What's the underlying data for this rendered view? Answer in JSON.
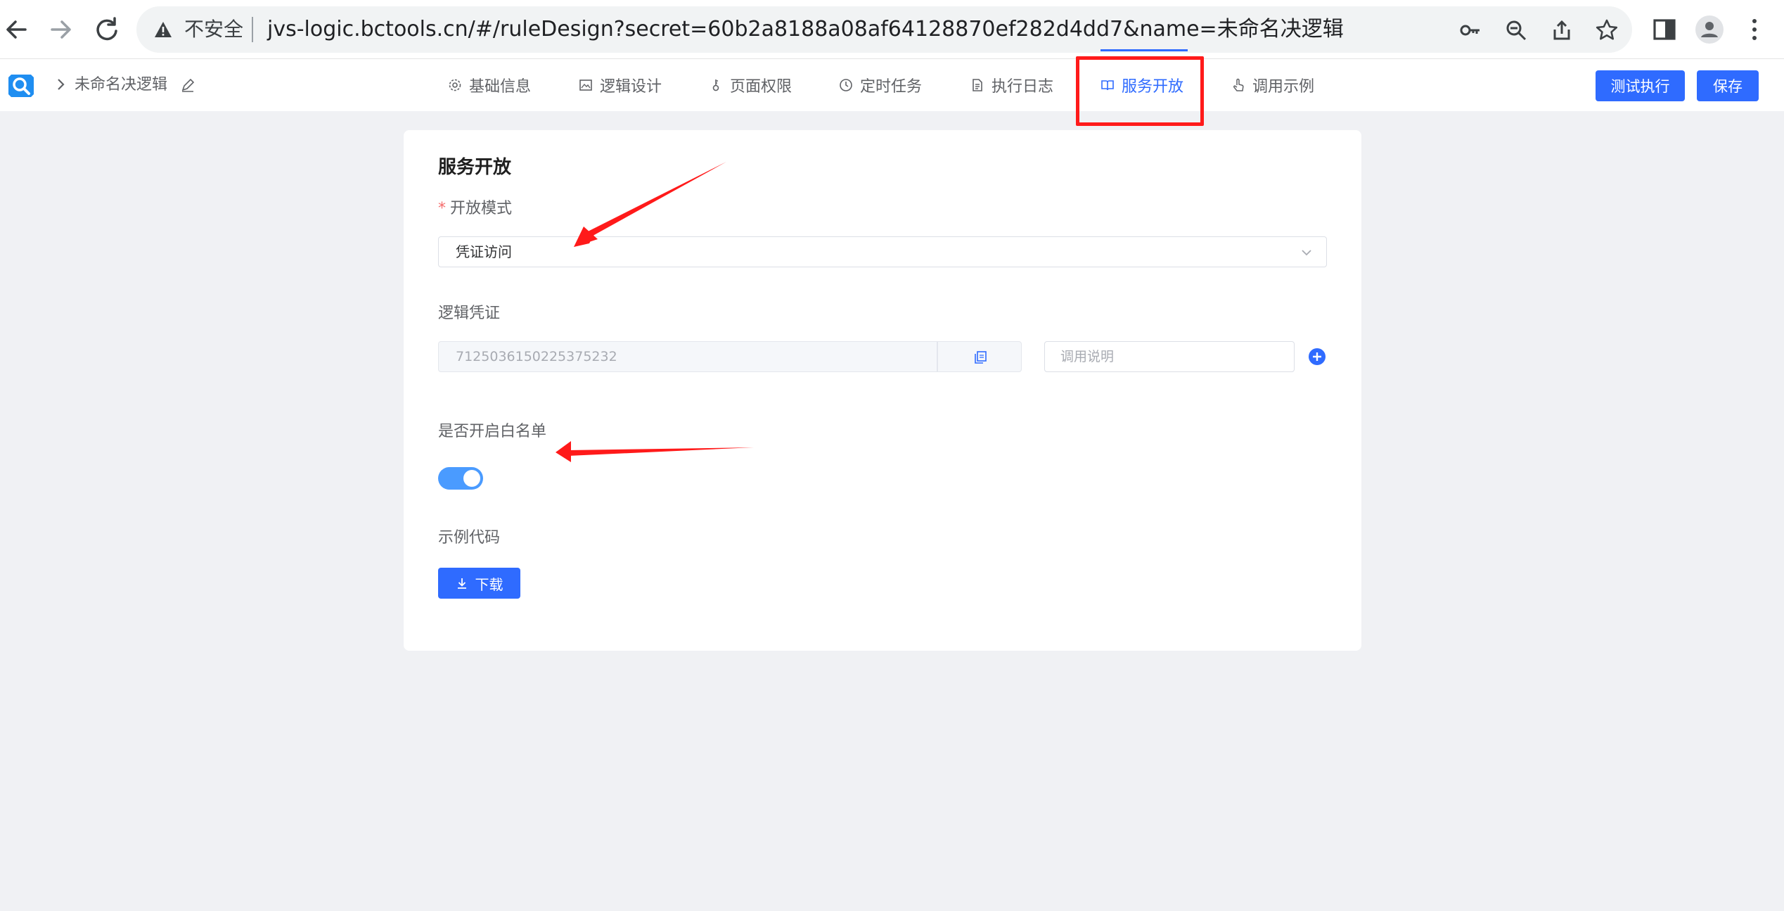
{
  "browser": {
    "insecure_label": "不安全",
    "url": "jvs-logic.bctools.cn/#/ruleDesign?secret=60b2a8188a08af64128870ef282d4dd7&name=未命名决逻辑"
  },
  "header": {
    "app_name": "未命名决逻辑",
    "tabs": [
      {
        "label": "基础信息",
        "icon": "gear-icon"
      },
      {
        "label": "逻辑设计",
        "icon": "image-icon"
      },
      {
        "label": "页面权限",
        "icon": "key-icon"
      },
      {
        "label": "定时任务",
        "icon": "clock-icon"
      },
      {
        "label": "执行日志",
        "icon": "document-icon"
      },
      {
        "label": "服务开放",
        "icon": "book-icon",
        "active": true
      },
      {
        "label": "调用示例",
        "icon": "pointer-icon"
      }
    ],
    "test_run_label": "测试执行",
    "save_label": "保存"
  },
  "card": {
    "title": "服务开放",
    "open_mode": {
      "required_mark": "*",
      "label": "开放模式",
      "value": "凭证访问"
    },
    "credential": {
      "label": "逻辑凭证",
      "value": "7125036150225375232",
      "description_placeholder": "调用说明"
    },
    "whitelist": {
      "label": "是否开启白名单",
      "enabled": true
    },
    "sample_code": {
      "label": "示例代码",
      "download_label": "下载"
    }
  },
  "colors": {
    "accent": "#2f6bff",
    "annotation": "#ff1a1a"
  }
}
